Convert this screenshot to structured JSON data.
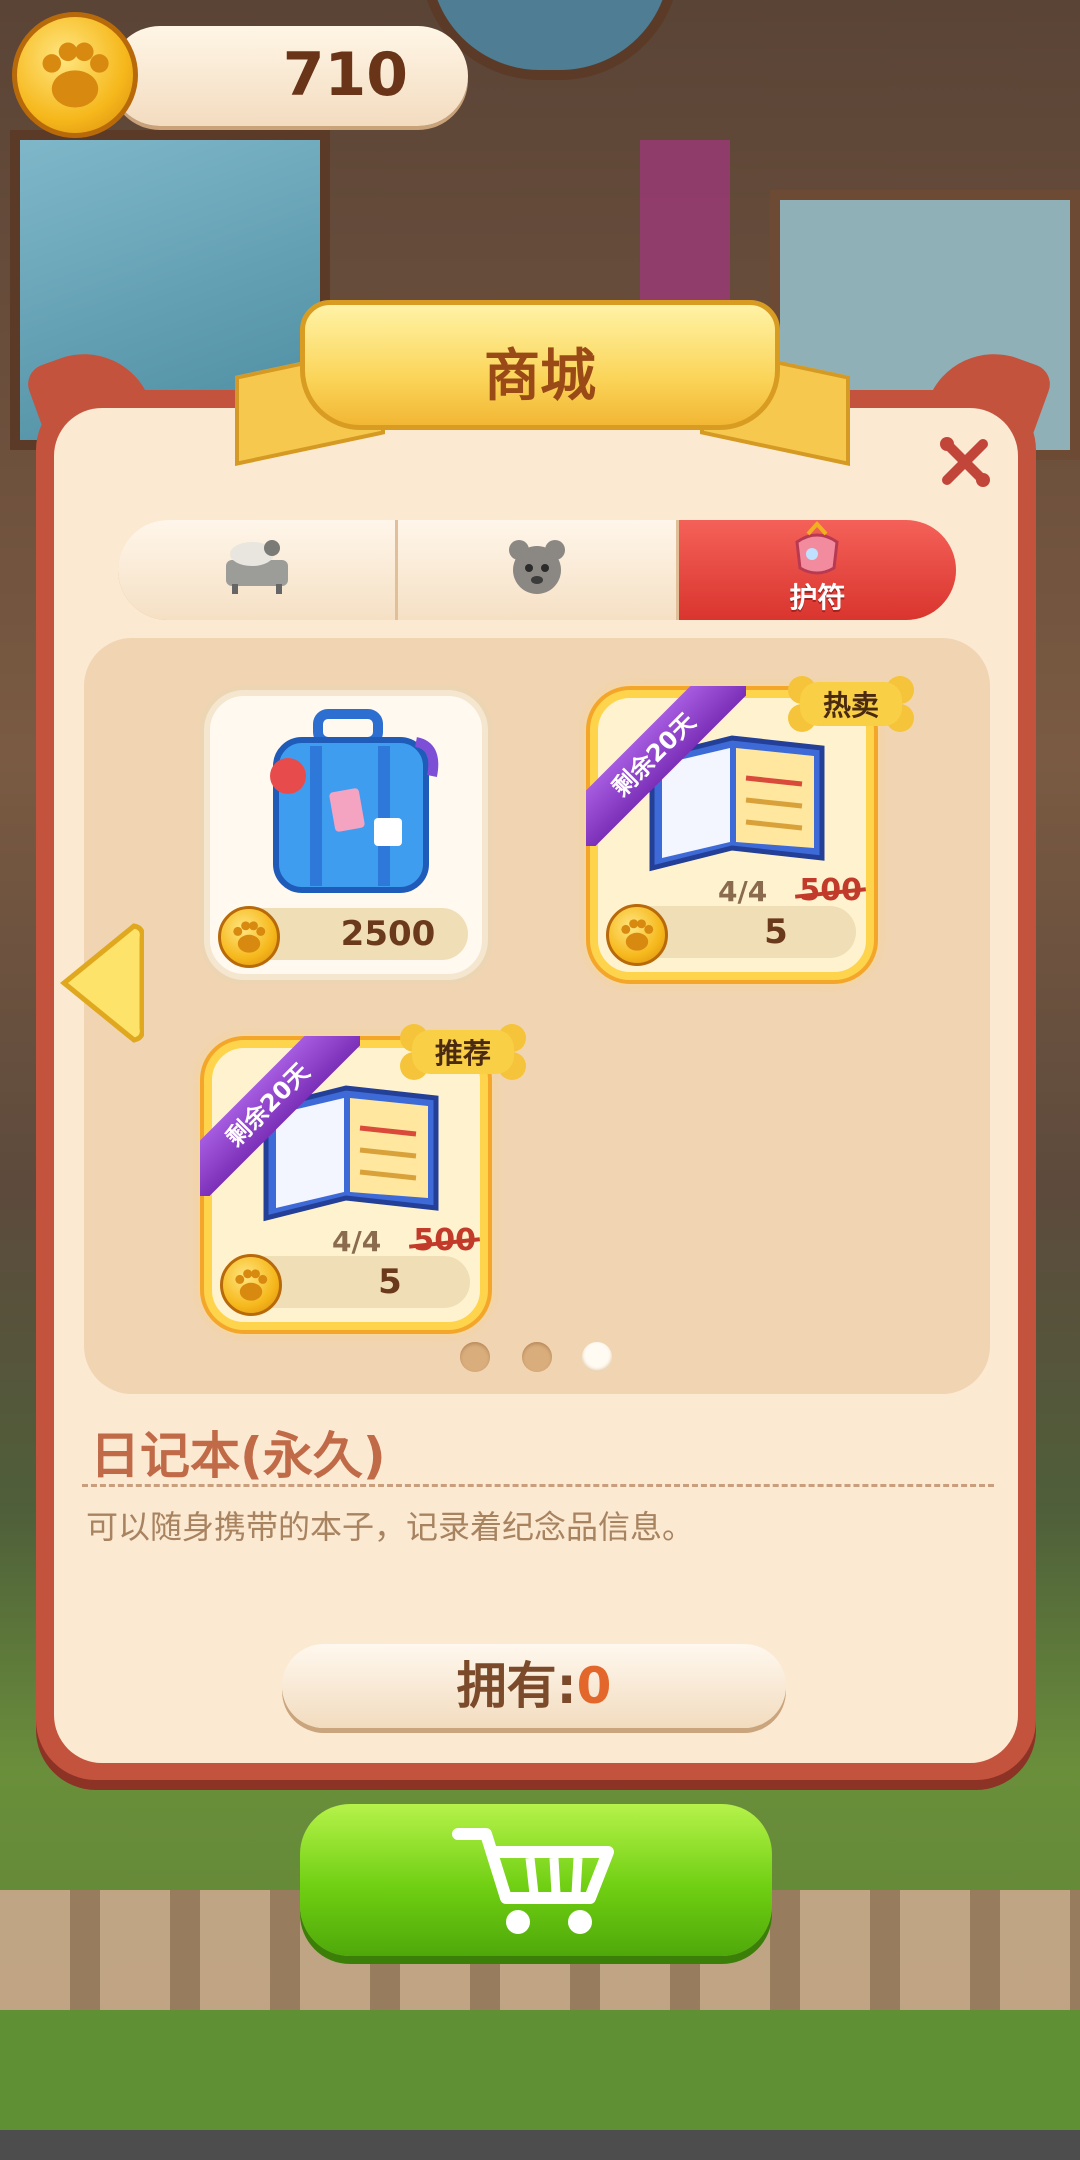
{
  "coins": {
    "value": "710",
    "icon": "paw-coin-icon"
  },
  "shop": {
    "title": "商城",
    "close_icon": "close-icon",
    "tabs": [
      {
        "icon": "furniture-icon",
        "label": ""
      },
      {
        "icon": "pet-icon",
        "label": ""
      },
      {
        "icon": "amulet-icon",
        "label": "护符",
        "active": true
      }
    ],
    "items": [
      {
        "icon": "suitcase-icon",
        "price": "2500",
        "stock": "",
        "old_price": "",
        "ribbon": "",
        "tag": ""
      },
      {
        "icon": "notebook-icon",
        "price": "5",
        "stock": "4/4",
        "old_price": "500",
        "ribbon": "剩余20天",
        "tag": "热卖"
      },
      {
        "icon": "notebook-icon",
        "price": "5",
        "stock": "4/4",
        "old_price": "500",
        "ribbon": "剩余20天",
        "tag": "推荐"
      }
    ],
    "pagination": {
      "pages": 3,
      "current": 3
    },
    "selected": {
      "name": "日记本(永久)",
      "description": "可以随身携带的本子，记录着纪念品信息。",
      "owned_label": "拥有:",
      "owned_count": "0"
    },
    "buy_icon": "cart-icon"
  },
  "colors": {
    "panel_border": "#c4533d",
    "panel_bg": "#fbe9d2",
    "tab_active": "#e2433b",
    "buy_green": "#6fcf12",
    "ribbon_purple": "#8b3ccc"
  }
}
